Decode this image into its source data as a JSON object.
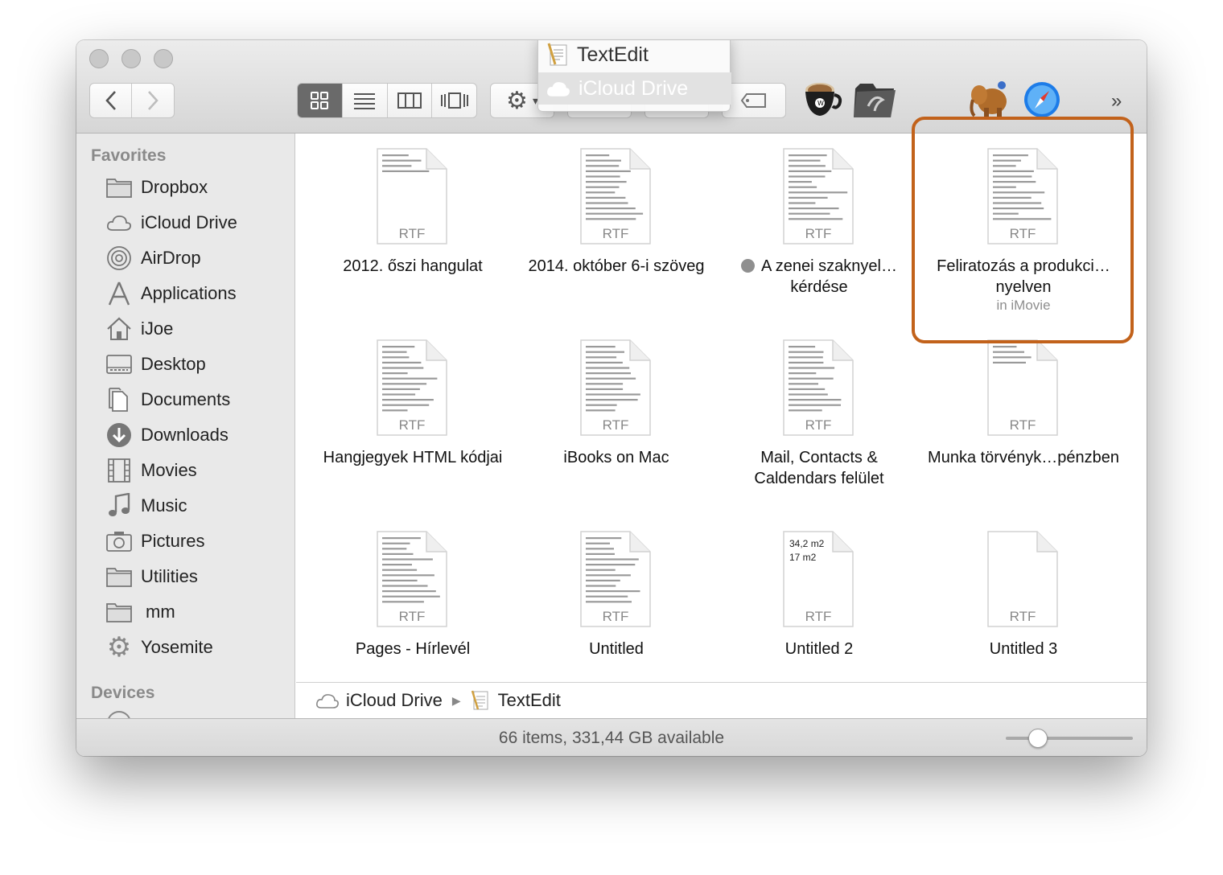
{
  "popup": {
    "items": [
      {
        "label": "TextEdit"
      },
      {
        "label": "iCloud Drive"
      }
    ]
  },
  "toolbar": {
    "overflow": "»",
    "view_modes": [
      "icon-view",
      "list-view",
      "column-view",
      "coverflow-view"
    ],
    "active_view": "icon-view"
  },
  "sidebar": {
    "favorites_heading": "Favorites",
    "devices_heading": "Devices",
    "items": [
      {
        "label": "Dropbox",
        "icon": "folder-icon"
      },
      {
        "label": "iCloud Drive",
        "icon": "cloud-icon"
      },
      {
        "label": "AirDrop",
        "icon": "airdrop-icon"
      },
      {
        "label": "Applications",
        "icon": "applications-icon"
      },
      {
        "label": "iJoe",
        "icon": "home-icon"
      },
      {
        "label": "Desktop",
        "icon": "desktop-icon"
      },
      {
        "label": "Documents",
        "icon": "documents-icon"
      },
      {
        "label": "Downloads",
        "icon": "downloads-icon"
      },
      {
        "label": "Movies",
        "icon": "movies-icon"
      },
      {
        "label": "Music",
        "icon": "music-icon"
      },
      {
        "label": "Pictures",
        "icon": "pictures-icon"
      },
      {
        "label": "Utilities",
        "icon": "folder-icon"
      },
      {
        "label": "mm",
        "icon": "folder-icon"
      },
      {
        "label": "Yosemite",
        "icon": "gear-icon"
      }
    ]
  },
  "files": [
    {
      "name": "2012. őszi hangulat",
      "type": "RTF"
    },
    {
      "name": "2014. október 6-i szöveg",
      "type": "RTF"
    },
    {
      "name": "A zenei szaknyel…kérdése",
      "type": "RTF",
      "tag": "gray"
    },
    {
      "name": "Feliratozás a produkci…nyelven",
      "type": "RTF",
      "sub": "in iMovie"
    },
    {
      "name": "Hangjegyek HTML kódjai",
      "type": "RTF"
    },
    {
      "name": "iBooks on Mac",
      "type": "RTF"
    },
    {
      "name": "Mail, Contacts & Caldendars felület",
      "type": "RTF"
    },
    {
      "name": "Munka törvényk…pénzben",
      "type": "RTF"
    },
    {
      "name": "Pages - Hírlevél",
      "type": "RTF"
    },
    {
      "name": "Untitled",
      "type": "RTF"
    },
    {
      "name": "Untitled 2",
      "type": "RTF",
      "preview": [
        "34,2 m2",
        "17 m2"
      ]
    },
    {
      "name": "Untitled 3",
      "type": "RTF"
    }
  ],
  "pathbar": {
    "segments": [
      {
        "label": "iCloud Drive",
        "icon": "cloud-icon"
      },
      {
        "label": "TextEdit",
        "icon": "textedit-icon"
      }
    ]
  },
  "status": {
    "text": "66 items, 331,44 GB available",
    "icon_size_level": 0.25
  },
  "colors": {
    "highlight": "#c2621b",
    "sidebar_bg": "#e9e9e9",
    "active_view": "#6a6a6a"
  }
}
